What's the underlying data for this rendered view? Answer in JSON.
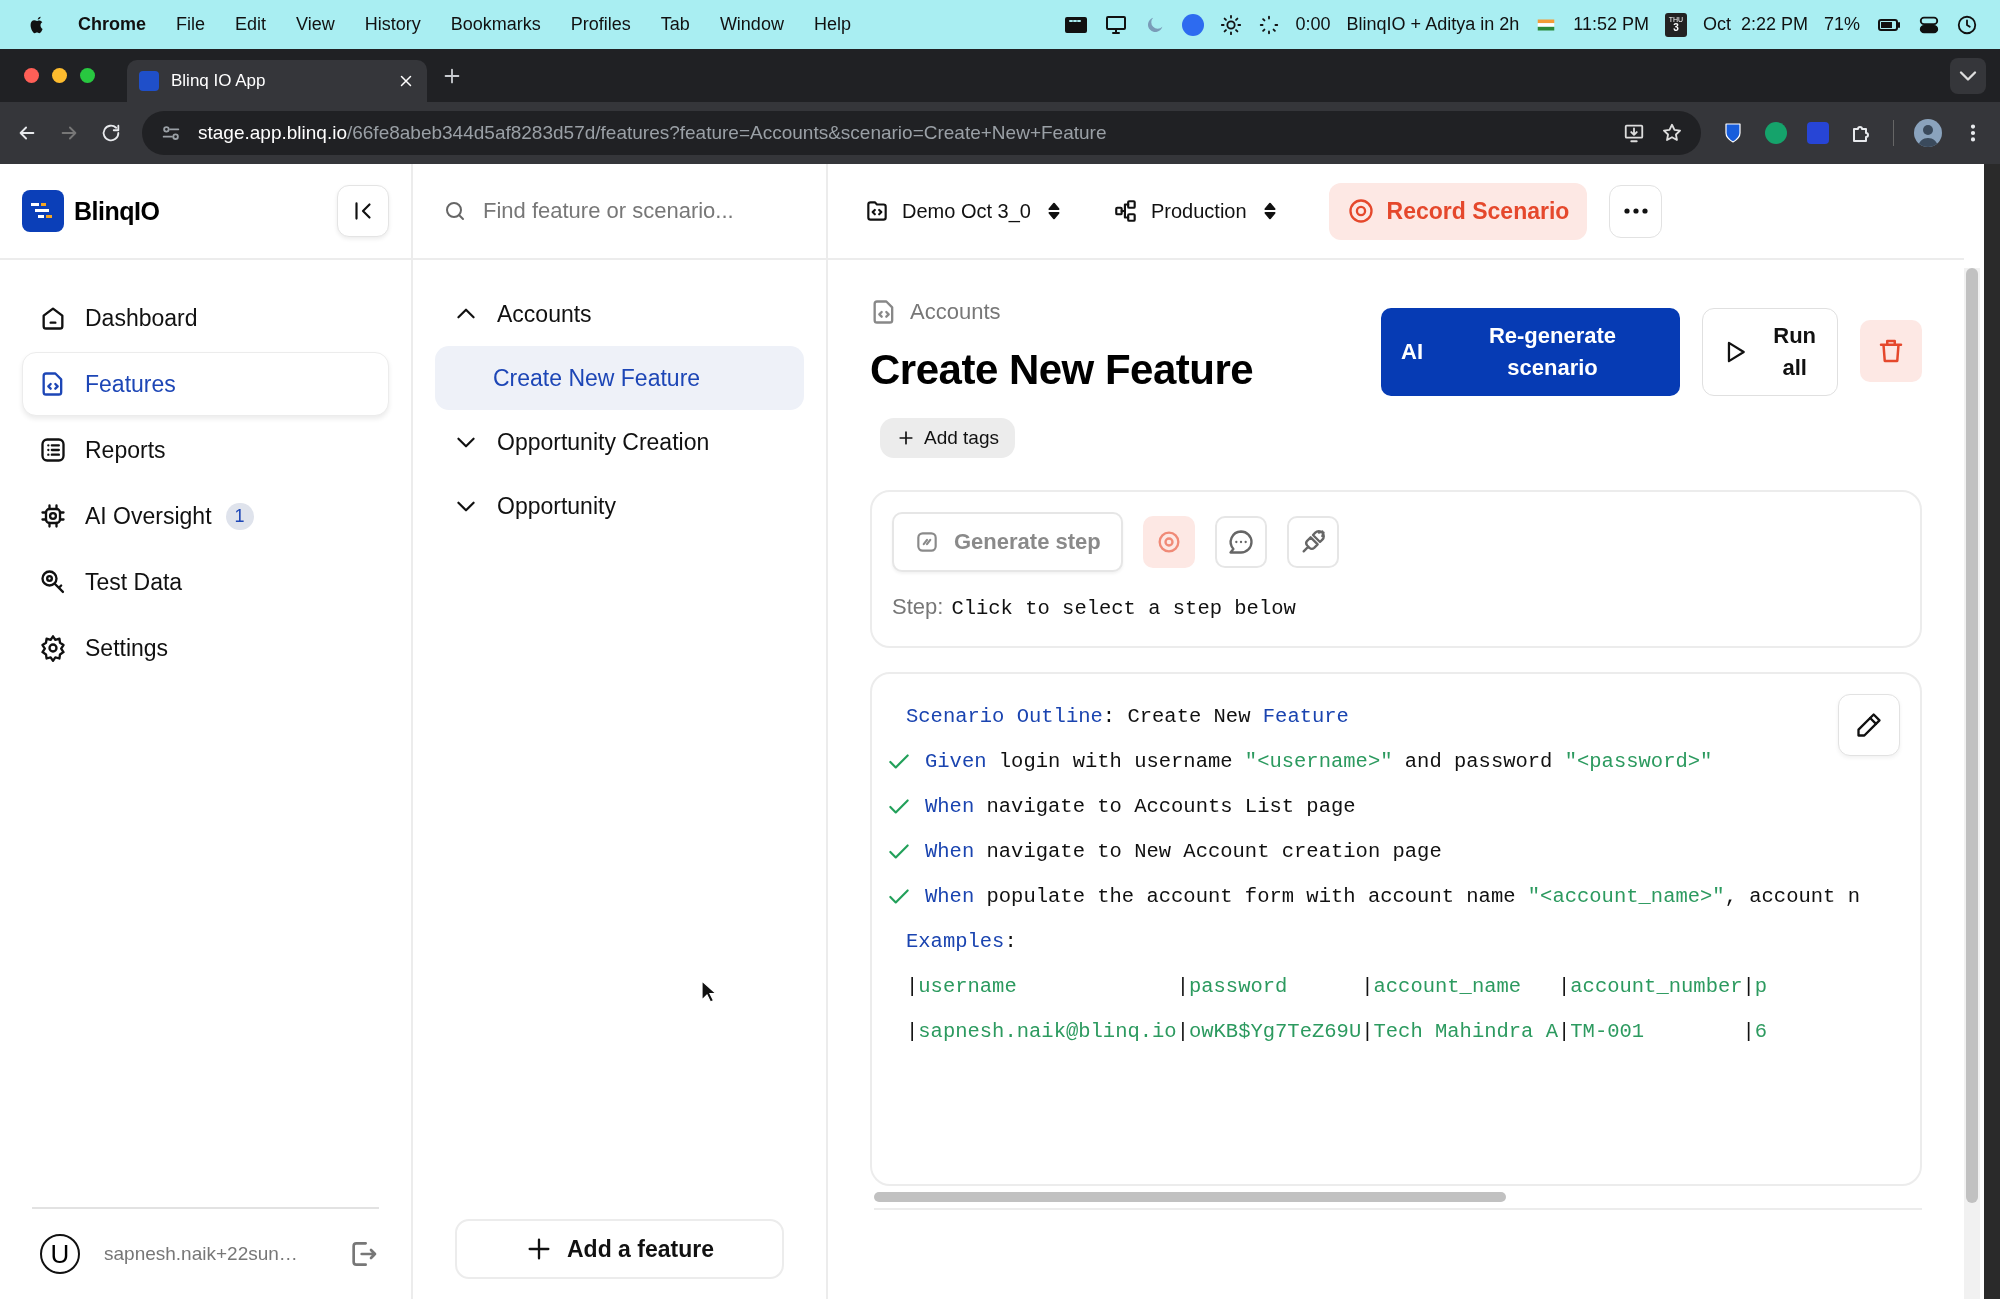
{
  "menu_bar": {
    "app": "Chrome",
    "items": [
      "File",
      "Edit",
      "View",
      "History",
      "Bookmarks",
      "Profiles",
      "Tab",
      "Window",
      "Help"
    ],
    "timer": "0:00",
    "event": "BlinqIO + Aditya in 2h",
    "world_time": "11:52 PM",
    "calendar_day": "THU",
    "calendar_date": "3",
    "clock": "Oct  2:22 PM",
    "battery": "71%"
  },
  "browser": {
    "tabs": [
      {
        "title": "Blinq IO App",
        "selected": true
      }
    ],
    "url_host": "stage.app.blinq.io",
    "url_path": "/66fe8abeb344d5af8283d57d/features?feature=Accounts&scenario=Create+New+Feature"
  },
  "sidebar": {
    "brand": "BlinqIO",
    "nav": [
      {
        "label": "Dashboard",
        "selected": false
      },
      {
        "label": "Features",
        "selected": true
      },
      {
        "label": "Reports",
        "selected": false
      },
      {
        "label": "AI Oversight",
        "badge": "1",
        "selected": false
      },
      {
        "label": "Test Data",
        "selected": false
      },
      {
        "label": "Settings",
        "selected": false
      }
    ],
    "user": {
      "initial": "U",
      "name": "sapnesh.naik+22sun…"
    }
  },
  "tree": {
    "search_placeholder": "Find feature or scenario...",
    "items": [
      {
        "label": "Accounts",
        "expanded": true,
        "selected": false,
        "children": [
          {
            "label": "Create New Feature",
            "selected": true
          }
        ]
      },
      {
        "label": "Opportunity Creation",
        "expanded": false,
        "selected": false
      },
      {
        "label": "Opportunity",
        "expanded": false,
        "selected": false
      }
    ],
    "add_button": "Add a feature"
  },
  "header": {
    "project": "Demo Oct 3_0",
    "environment": "Production",
    "record_button": "Record Scenario"
  },
  "feature": {
    "breadcrumb": "Accounts",
    "title": "Create New Feature",
    "add_tags": "Add tags",
    "regenerate": {
      "badge": "AI",
      "label": "Re-generate scenario"
    },
    "run_all": "Run all",
    "step_panel": {
      "generate_label": "Generate step",
      "generate_disabled": true,
      "step_label": "Step:",
      "step_hint": "Click to select a step below"
    },
    "script": {
      "lines": [
        {
          "kind": "outline",
          "segments": [
            {
              "text": "Scenario Outline",
              "kind": "keyword"
            },
            {
              "text": ": Create New ",
              "kind": "plain"
            },
            {
              "text": "Feature",
              "kind": "keyword"
            }
          ]
        },
        {
          "kind": "step",
          "passed": true,
          "segments": [
            {
              "text": "Given",
              "kind": "keyword"
            },
            {
              "text": " login with username ",
              "kind": "plain"
            },
            {
              "text": "\"<username>\"",
              "kind": "string"
            },
            {
              "text": " and password ",
              "kind": "plain"
            },
            {
              "text": "\"<password>\"",
              "kind": "string"
            }
          ]
        },
        {
          "kind": "step",
          "passed": true,
          "segments": [
            {
              "text": "When",
              "kind": "keyword"
            },
            {
              "text": " navigate to Accounts List page",
              "kind": "plain"
            }
          ]
        },
        {
          "kind": "step",
          "passed": true,
          "segments": [
            {
              "text": "When",
              "kind": "keyword"
            },
            {
              "text": " navigate to New Account creation page",
              "kind": "plain"
            }
          ]
        },
        {
          "kind": "step",
          "passed": true,
          "segments": [
            {
              "text": "When",
              "kind": "keyword"
            },
            {
              "text": " populate the account form with account name ",
              "kind": "plain"
            },
            {
              "text": "\"<account_name>\"",
              "kind": "string"
            },
            {
              "text": ", account n",
              "kind": "plain"
            }
          ]
        },
        {
          "kind": "outline",
          "segments": [
            {
              "text": "Examples",
              "kind": "keyword"
            },
            {
              "text": ":",
              "kind": "plain"
            }
          ]
        }
      ],
      "examples": {
        "separator": "|",
        "columns": [
          "username",
          "password",
          "account_name",
          "account_number",
          "p"
        ],
        "rows": [
          [
            "sapnesh.naik@blinq.io",
            "owKB$Yg7TeZ69U",
            "Tech Mahindra A",
            "TM-001",
            "6"
          ]
        ]
      }
    }
  }
}
